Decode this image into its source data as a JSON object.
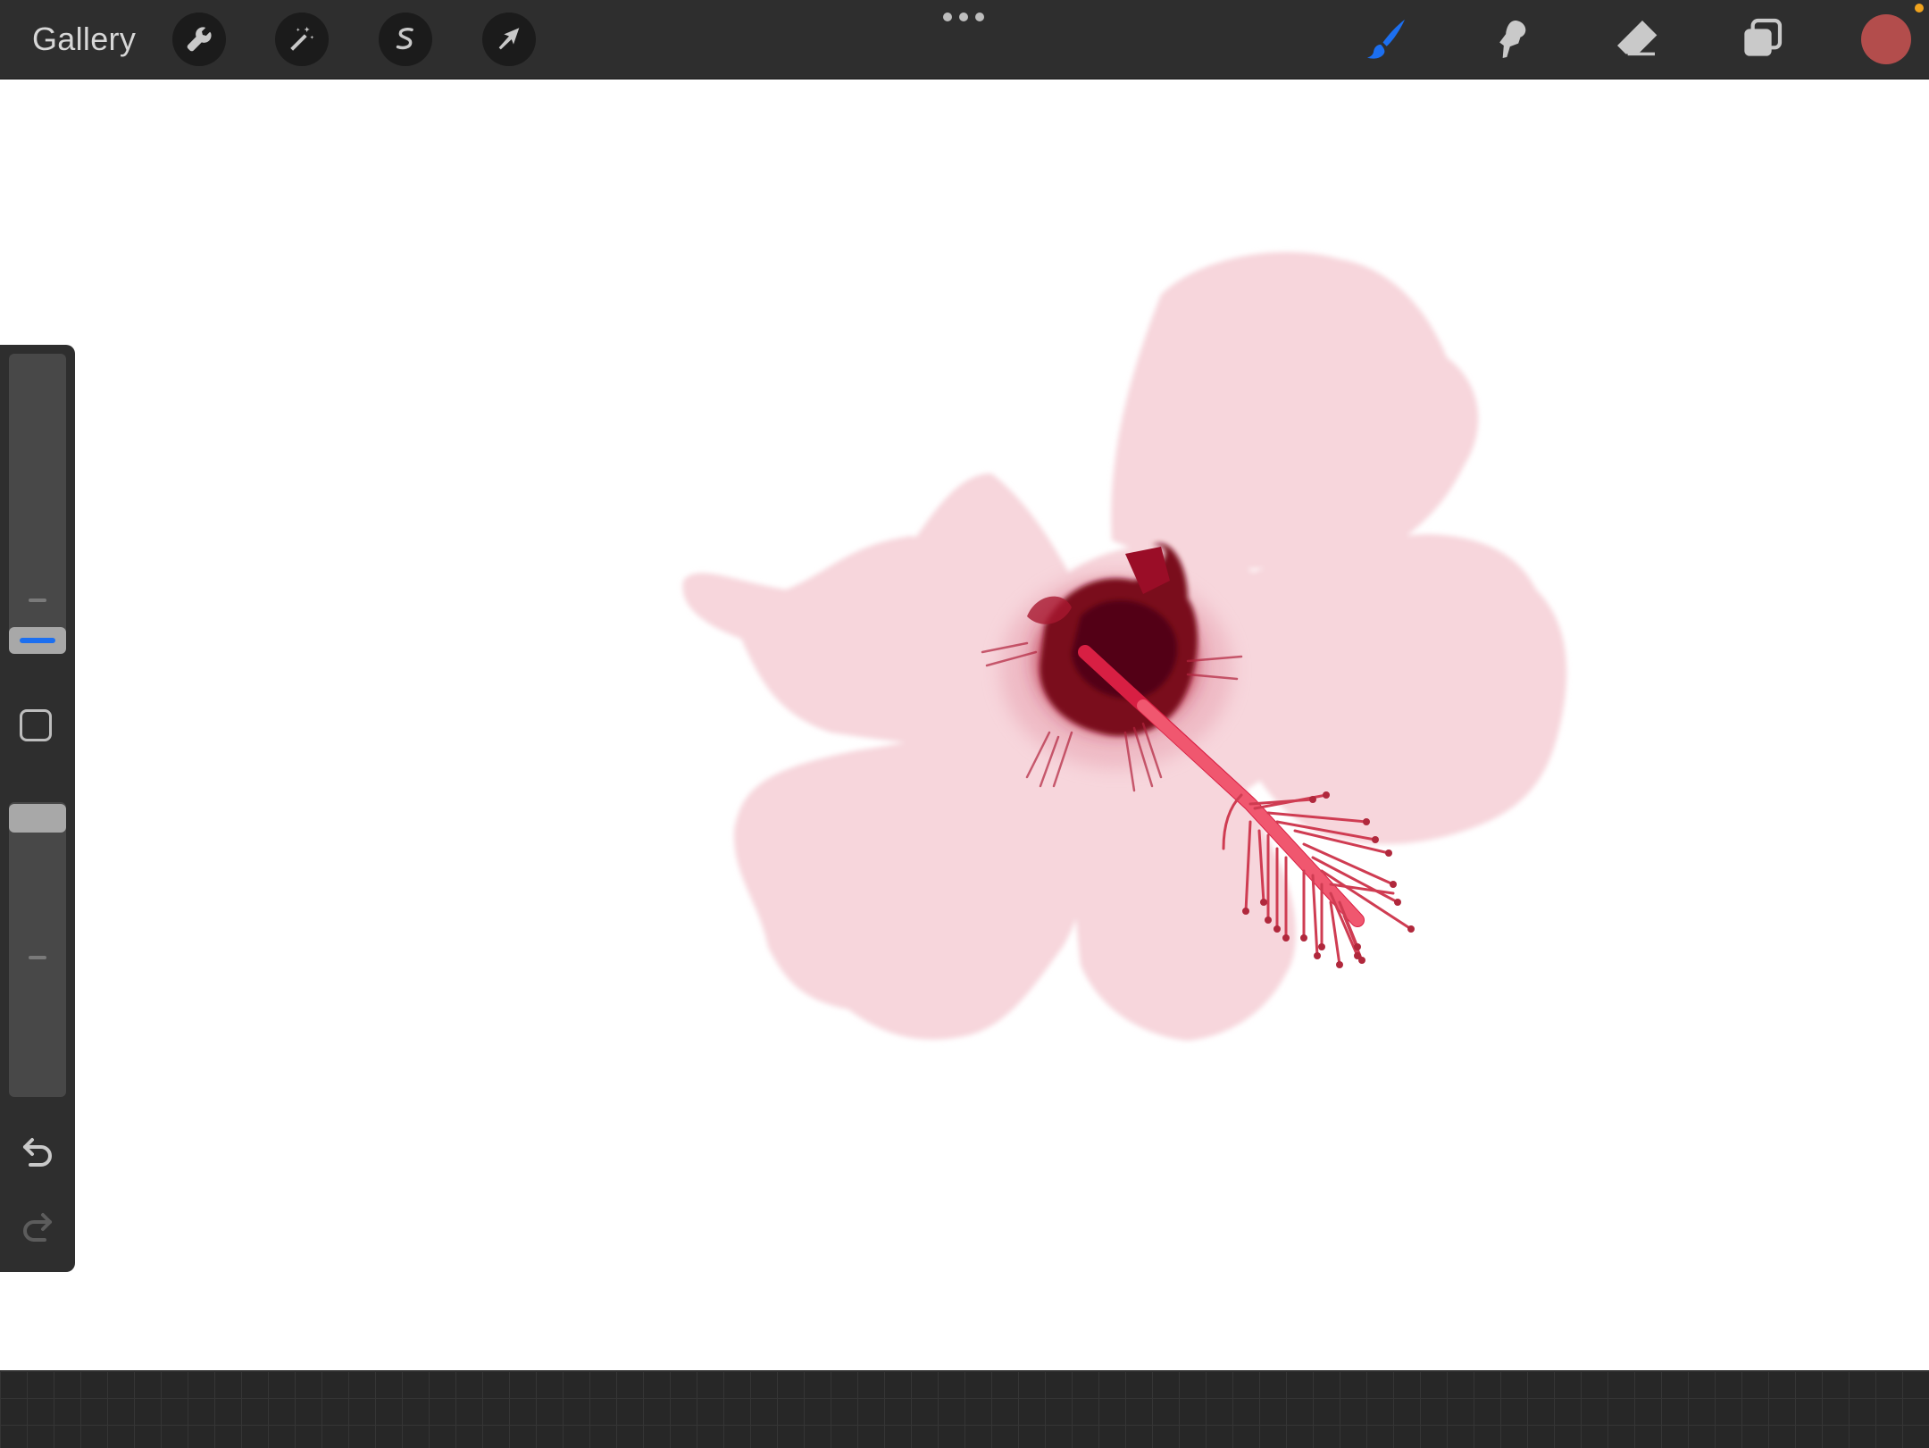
{
  "toolbar": {
    "gallery_label": "Gallery",
    "left_tools": [
      {
        "name": "actions",
        "icon": "wrench-icon"
      },
      {
        "name": "adjustments",
        "icon": "magic-wand-icon"
      },
      {
        "name": "selection",
        "icon": "selection-s-icon"
      },
      {
        "name": "transform",
        "icon": "arrow-cursor-icon"
      }
    ],
    "center_icon": "more-dots-icon",
    "right_tools": [
      {
        "name": "brush",
        "icon": "brush-icon",
        "active": true
      },
      {
        "name": "smudge",
        "icon": "smudge-icon",
        "active": false
      },
      {
        "name": "eraser",
        "icon": "eraser-icon",
        "active": false
      },
      {
        "name": "layers",
        "icon": "layers-icon",
        "active": false
      }
    ],
    "current_color": "#b34d4c",
    "active_color": "#1c6ff0"
  },
  "sidebar": {
    "brush_size_level": 0.1,
    "opacity_level": 0.95,
    "modify_icon": "square-icon",
    "undo_icon": "undo-icon",
    "redo_icon": "redo-icon"
  },
  "canvas": {
    "artwork": "hibiscus-flower",
    "petal_color": "#f7d6dc",
    "center_color": "#8e0c22",
    "stamen_color": "#e84a64"
  }
}
